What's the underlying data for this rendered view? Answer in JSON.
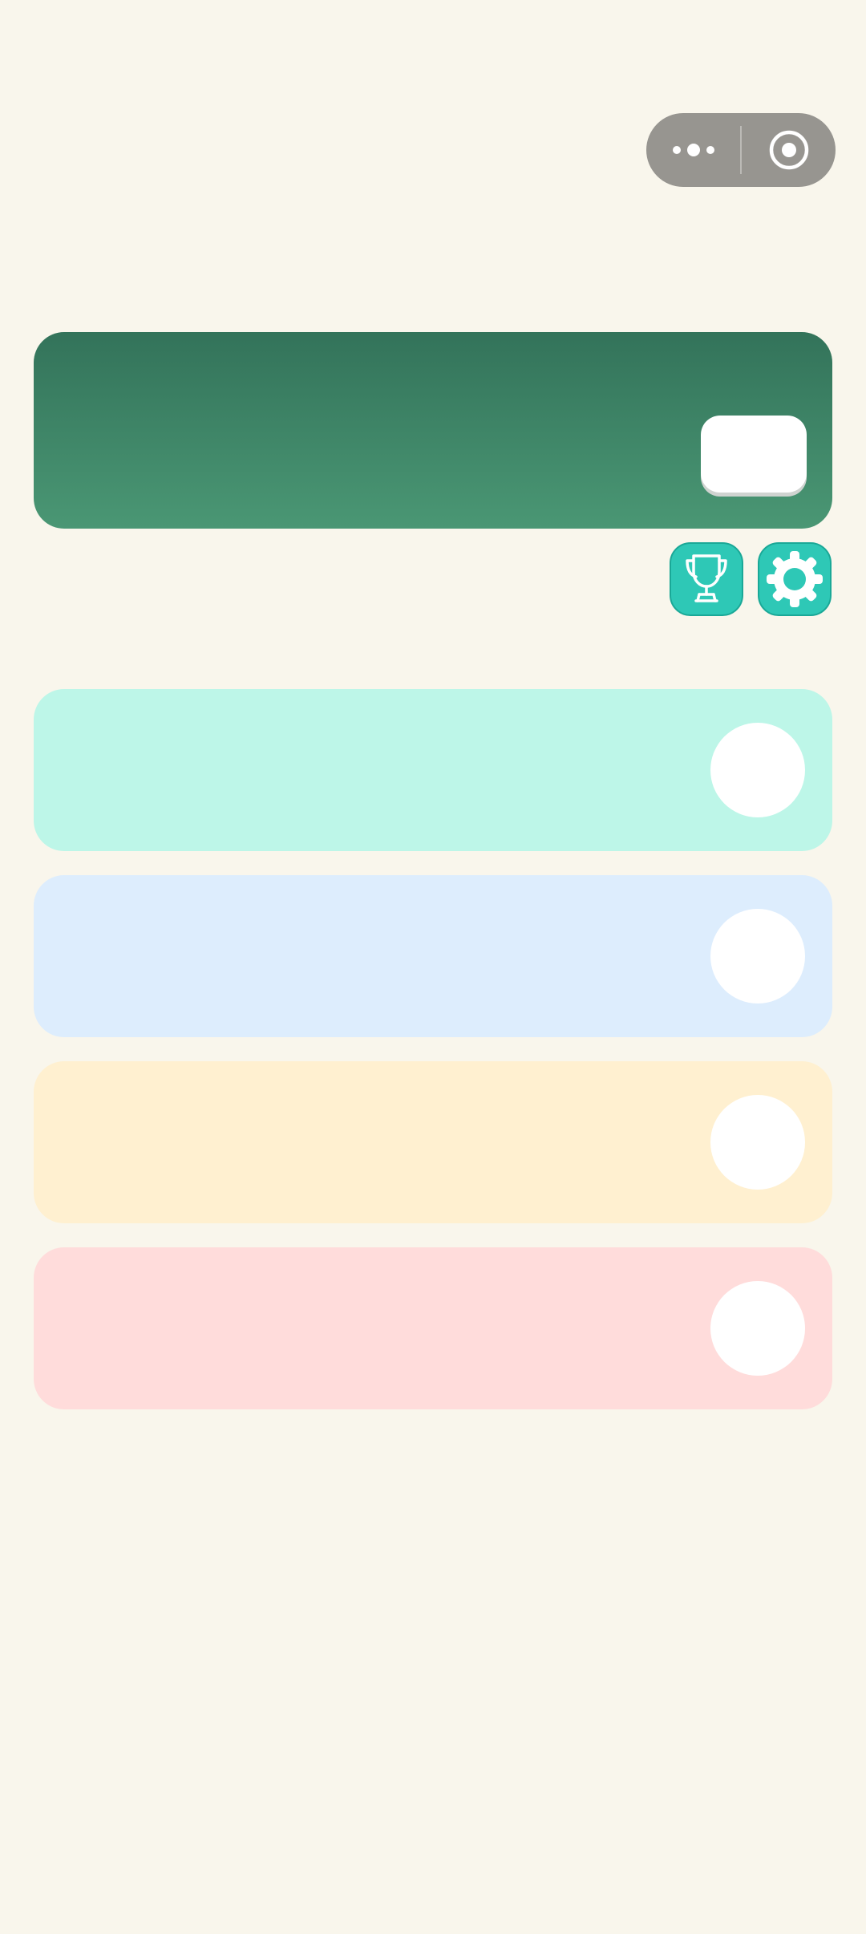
{
  "capsule": {
    "menu_icon": "more-dots-icon",
    "close_icon": "target-circle-icon"
  },
  "banner": {
    "color_top": "#33735a",
    "color_bottom": "#4a9774"
  },
  "icon_buttons": [
    {
      "icon": "trophy-icon",
      "color": "#2ec8b6"
    },
    {
      "icon": "gear-icon",
      "color": "#2ec8b6"
    }
  ],
  "cards": [
    {
      "color": "#bdf6e8"
    },
    {
      "color": "#ddedfd"
    },
    {
      "color": "#fff0d0"
    },
    {
      "color": "#ffdcdb"
    }
  ]
}
